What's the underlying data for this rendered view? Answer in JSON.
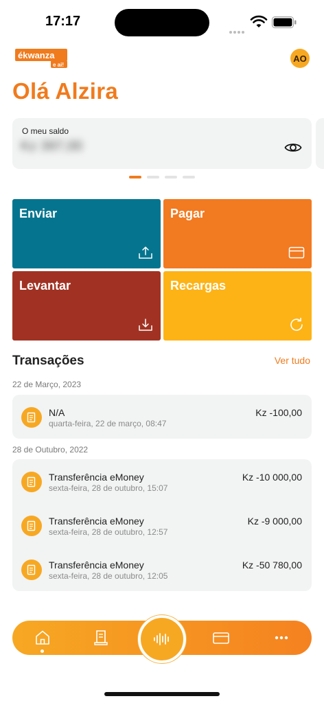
{
  "status_bar": {
    "time": "17:17"
  },
  "header": {
    "logo_text": "ékwanza",
    "logo_sub": "e ai!",
    "avatar_initials": "AO",
    "greeting": "Olá Alzira"
  },
  "balance": {
    "label": "O meu saldo",
    "value": "Kz 397,00",
    "value_hidden": true,
    "pagination": {
      "pages": 4,
      "active": 0
    }
  },
  "actions": [
    {
      "label": "Enviar",
      "icon": "upload-icon",
      "color": "#05758f"
    },
    {
      "label": "Pagar",
      "icon": "card-icon",
      "color": "#f27a21"
    },
    {
      "label": "Levantar",
      "icon": "download-icon",
      "color": "#a13223"
    },
    {
      "label": "Recargas",
      "icon": "refresh-icon",
      "color": "#fdb316"
    }
  ],
  "transactions": {
    "title": "Transações",
    "see_all": "Ver tudo",
    "groups": [
      {
        "date": "22 de Março, 2023",
        "items": [
          {
            "name": "N/A",
            "datetime": "quarta-feira, 22 de março, 08:47",
            "amount": "Kz -100,00"
          }
        ]
      },
      {
        "date": "28 de Outubro, 2022",
        "items": [
          {
            "name": "Transferência eMoney",
            "datetime": "sexta-feira, 28 de outubro, 15:07",
            "amount": "Kz -10 000,00"
          },
          {
            "name": "Transferência eMoney",
            "datetime": "sexta-feira, 28 de outubro, 12:57",
            "amount": "Kz -9 000,00"
          },
          {
            "name": "Transferência eMoney",
            "datetime": "sexta-feira, 28 de outubro, 12:05",
            "amount": "Kz -50 780,00"
          }
        ]
      }
    ]
  },
  "bottom_nav": {
    "items": [
      "home-icon",
      "receipt-icon",
      "voice-icon",
      "card-icon",
      "more-icon"
    ],
    "active": "home-icon"
  },
  "colors": {
    "brand_orange": "#f07b1d",
    "brand_yellow": "#f7a823"
  }
}
